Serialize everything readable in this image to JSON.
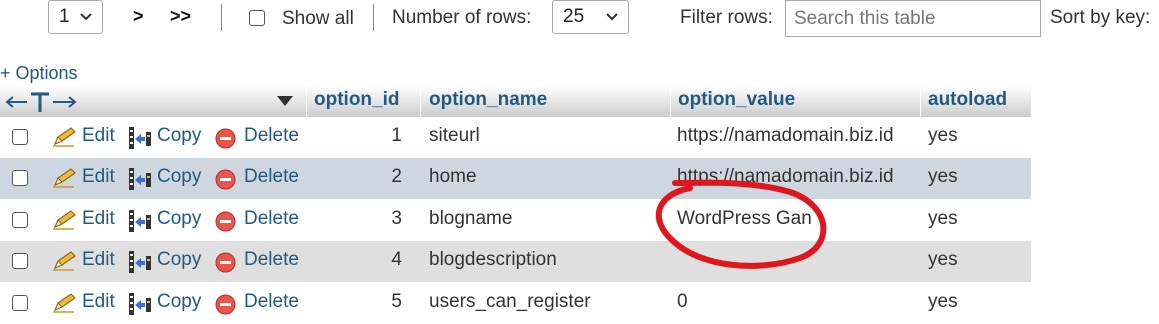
{
  "nav": {
    "page_select": "1",
    "next": ">",
    "last": ">>",
    "show_all_label": "Show all",
    "rows_label": "Number of rows:",
    "rows_value": "25",
    "filter_label": "Filter rows:",
    "filter_placeholder": "Search this table",
    "sort_label": "Sort by key:"
  },
  "options_link": "+ Options",
  "table": {
    "columns": [
      "option_id",
      "option_name",
      "option_value",
      "autoload"
    ],
    "actions": {
      "edit": "Edit",
      "copy": "Copy",
      "delete": "Delete"
    },
    "rows": [
      {
        "option_id": "1",
        "option_name": "siteurl",
        "option_value": "https://namadomain.biz.id",
        "autoload": "yes"
      },
      {
        "option_id": "2",
        "option_name": "home",
        "option_value": "https://namadomain.biz.id",
        "autoload": "yes"
      },
      {
        "option_id": "3",
        "option_name": "blogname",
        "option_value": "WordPress Gan",
        "autoload": "yes"
      },
      {
        "option_id": "4",
        "option_name": "blogdescription",
        "option_value": "",
        "autoload": "yes"
      },
      {
        "option_id": "5",
        "option_name": "users_can_register",
        "option_value": "0",
        "autoload": "yes"
      }
    ]
  },
  "colors": {
    "link": "#235a81",
    "row_alt": "#dfdfdf",
    "row_hover": "#ced6df",
    "annotation": "#e0161e"
  }
}
